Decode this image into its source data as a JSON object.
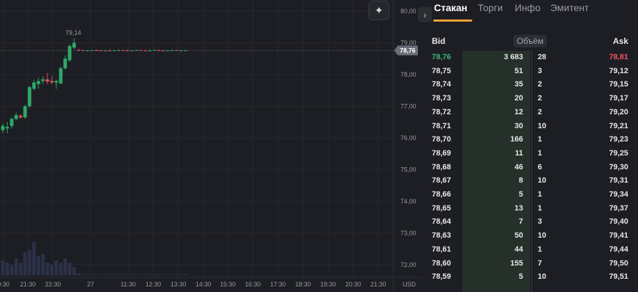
{
  "toolbar": {
    "sparkle_icon": "sparkle-icon",
    "collapse_icon": "chevron-right-icon"
  },
  "tabs": [
    {
      "label": "Стакан",
      "active": true
    },
    {
      "label": "Торги",
      "active": false
    },
    {
      "label": "Инфо",
      "active": false
    },
    {
      "label": "Эмитент",
      "active": false
    }
  ],
  "order_book": {
    "bid_header": "Bid",
    "volume_header": "Объём",
    "ask_header": "Ask",
    "rows": [
      {
        "bid": "78,76",
        "bid_volume": "3 683",
        "ask_volume": "28",
        "ask": "78,81"
      },
      {
        "bid": "78,75",
        "bid_volume": "51",
        "ask_volume": "3",
        "ask": "79,12"
      },
      {
        "bid": "78,74",
        "bid_volume": "35",
        "ask_volume": "2",
        "ask": "79,15"
      },
      {
        "bid": "78,73",
        "bid_volume": "20",
        "ask_volume": "2",
        "ask": "79,17"
      },
      {
        "bid": "78,72",
        "bid_volume": "12",
        "ask_volume": "2",
        "ask": "79,20"
      },
      {
        "bid": "78,71",
        "bid_volume": "30",
        "ask_volume": "10",
        "ask": "79,21"
      },
      {
        "bid": "78,70",
        "bid_volume": "166",
        "ask_volume": "1",
        "ask": "79,23"
      },
      {
        "bid": "78,69",
        "bid_volume": "11",
        "ask_volume": "1",
        "ask": "79,25"
      },
      {
        "bid": "78,68",
        "bid_volume": "46",
        "ask_volume": "6",
        "ask": "79,30"
      },
      {
        "bid": "78,67",
        "bid_volume": "8",
        "ask_volume": "10",
        "ask": "79,31"
      },
      {
        "bid": "78,66",
        "bid_volume": "5",
        "ask_volume": "1",
        "ask": "79,34"
      },
      {
        "bid": "78,65",
        "bid_volume": "13",
        "ask_volume": "1",
        "ask": "79,37"
      },
      {
        "bid": "78,64",
        "bid_volume": "7",
        "ask_volume": "3",
        "ask": "79,40"
      },
      {
        "bid": "78,63",
        "bid_volume": "50",
        "ask_volume": "10",
        "ask": "79,41"
      },
      {
        "bid": "78,61",
        "bid_volume": "44",
        "ask_volume": "1",
        "ask": "79,44"
      },
      {
        "bid": "78,60",
        "bid_volume": "155",
        "ask_volume": "7",
        "ask": "79,50"
      },
      {
        "bid": "78,59",
        "bid_volume": "5",
        "ask_volume": "10",
        "ask": "79,51"
      }
    ],
    "colors": {
      "bid_best": "#3fb877",
      "ask_best": "#f05561",
      "volume_fill": "#26302a"
    }
  },
  "chart_data": {
    "type": "candlestick",
    "y_ticks": [
      "80,00",
      "79,00",
      "78,00",
      "77,00",
      "76,00",
      "75,00",
      "74,00",
      "73,00",
      "72,00"
    ],
    "y_tick_values": [
      80,
      79,
      78,
      77,
      76,
      75,
      74,
      73,
      72
    ],
    "ylim": [
      71.75,
      80.25
    ],
    "x_ticks": [
      "0:30",
      "21:30",
      "22:30",
      "27",
      "11:30",
      "12:30",
      "13:30",
      "14:30",
      "15:30",
      "16:30",
      "17:30",
      "18:30",
      "19:30",
      "20:30",
      "21:30"
    ],
    "currency_label": "USD",
    "current_price_label": "78,76",
    "current_price": 78.76,
    "high_label": "79,14",
    "high_value": 79.14,
    "colors": {
      "up": "#2fa86a",
      "down": "#e0505c",
      "volume": "#2d3148",
      "price_tag": "#6b6e78"
    },
    "candles": [
      {
        "o": 76.25,
        "h": 76.45,
        "l": 76.15,
        "c": 76.38
      },
      {
        "o": 76.3,
        "h": 76.5,
        "l": 76.15,
        "c": 76.35
      },
      {
        "o": 76.38,
        "h": 76.65,
        "l": 76.3,
        "c": 76.6
      },
      {
        "o": 76.6,
        "h": 76.8,
        "l": 76.55,
        "c": 76.72
      },
      {
        "o": 76.7,
        "h": 76.75,
        "l": 76.6,
        "c": 76.65
      },
      {
        "o": 76.65,
        "h": 77.05,
        "l": 76.6,
        "c": 77.0
      },
      {
        "o": 77.0,
        "h": 77.65,
        "l": 76.95,
        "c": 77.6
      },
      {
        "o": 77.55,
        "h": 77.85,
        "l": 77.5,
        "c": 77.75
      },
      {
        "o": 77.7,
        "h": 77.9,
        "l": 77.55,
        "c": 77.8
      },
      {
        "o": 77.8,
        "h": 77.95,
        "l": 77.7,
        "c": 77.85
      },
      {
        "o": 77.85,
        "h": 78.05,
        "l": 77.7,
        "c": 77.78
      },
      {
        "o": 77.8,
        "h": 77.95,
        "l": 77.7,
        "c": 77.75
      },
      {
        "o": 77.75,
        "h": 77.85,
        "l": 77.55,
        "c": 77.8
      },
      {
        "o": 77.72,
        "h": 78.25,
        "l": 77.7,
        "c": 78.2
      },
      {
        "o": 78.2,
        "h": 78.6,
        "l": 78.15,
        "c": 78.5
      },
      {
        "o": 78.45,
        "h": 78.95,
        "l": 78.4,
        "c": 78.9
      },
      {
        "o": 78.85,
        "h": 79.14,
        "l": 78.8,
        "c": 79.0
      },
      {
        "o": 78.78,
        "h": 78.8,
        "l": 78.74,
        "c": 78.76
      },
      {
        "o": 78.77,
        "h": 78.78,
        "l": 78.74,
        "c": 78.75
      },
      {
        "o": 78.75,
        "h": 78.77,
        "l": 78.73,
        "c": 78.76
      },
      {
        "o": 78.76,
        "h": 78.78,
        "l": 78.74,
        "c": 78.77
      },
      {
        "o": 78.77,
        "h": 78.79,
        "l": 78.75,
        "c": 78.76
      },
      {
        "o": 78.76,
        "h": 78.78,
        "l": 78.74,
        "c": 78.75
      },
      {
        "o": 78.75,
        "h": 78.77,
        "l": 78.73,
        "c": 78.76
      },
      {
        "o": 78.76,
        "h": 78.78,
        "l": 78.74,
        "c": 78.75
      },
      {
        "o": 78.75,
        "h": 78.77,
        "l": 78.74,
        "c": 78.76
      },
      {
        "o": 78.76,
        "h": 78.78,
        "l": 78.74,
        "c": 78.77
      },
      {
        "o": 78.77,
        "h": 78.78,
        "l": 78.74,
        "c": 78.76
      },
      {
        "o": 78.76,
        "h": 78.78,
        "l": 78.74,
        "c": 78.75
      },
      {
        "o": 78.75,
        "h": 78.77,
        "l": 78.73,
        "c": 78.76
      },
      {
        "o": 78.76,
        "h": 78.78,
        "l": 78.75,
        "c": 78.77
      },
      {
        "o": 78.77,
        "h": 78.78,
        "l": 78.74,
        "c": 78.76
      },
      {
        "o": 78.76,
        "h": 78.77,
        "l": 78.74,
        "c": 78.75
      },
      {
        "o": 78.75,
        "h": 78.78,
        "l": 78.74,
        "c": 78.76
      },
      {
        "o": 78.76,
        "h": 78.78,
        "l": 78.75,
        "c": 78.77
      },
      {
        "o": 78.77,
        "h": 78.78,
        "l": 78.74,
        "c": 78.76
      },
      {
        "o": 78.76,
        "h": 78.78,
        "l": 78.74,
        "c": 78.75
      },
      {
        "o": 78.75,
        "h": 78.77,
        "l": 78.74,
        "c": 78.76
      },
      {
        "o": 78.76,
        "h": 78.78,
        "l": 78.74,
        "c": 78.77
      },
      {
        "o": 78.77,
        "h": 78.78,
        "l": 78.75,
        "c": 78.76
      },
      {
        "o": 78.76,
        "h": 78.78,
        "l": 78.74,
        "c": 78.76
      },
      {
        "o": 78.76,
        "h": 78.77,
        "l": 78.75,
        "c": 78.76
      }
    ],
    "volumes": [
      0.35,
      0.3,
      0.25,
      0.4,
      0.3,
      0.55,
      0.6,
      0.8,
      0.45,
      0.5,
      0.3,
      0.25,
      0.35,
      0.3,
      0.4,
      0.3,
      0.2,
      0.05,
      0.02,
      0.03,
      0.02,
      0.02,
      0.02,
      0.02,
      0.02,
      0.02,
      0.02,
      0.02,
      0.02,
      0.02,
      0.02,
      0.02,
      0.02,
      0.02,
      0.02,
      0.02,
      0.02,
      0.02,
      0.02,
      0.02,
      0.02,
      0.02
    ]
  }
}
